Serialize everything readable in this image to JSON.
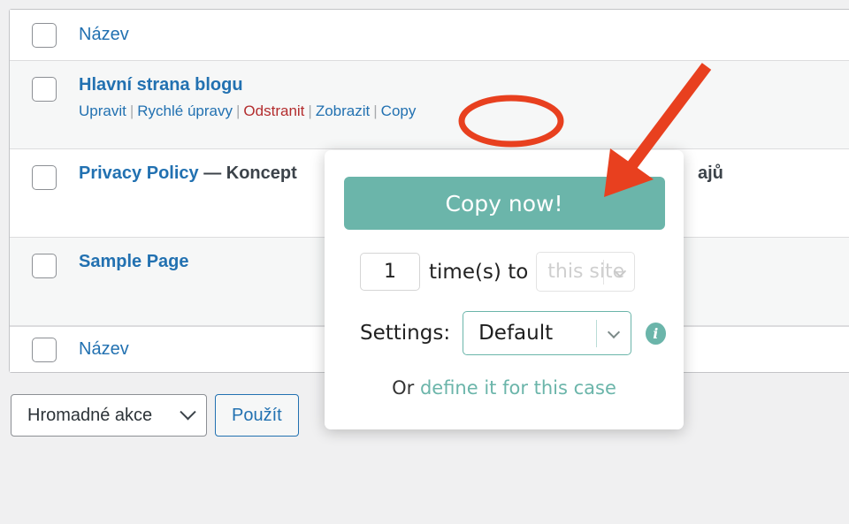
{
  "table": {
    "header": {
      "column_title": "Název"
    },
    "footer": {
      "column_title": "Název"
    },
    "rows": [
      {
        "title": "Hlavní strana blogu",
        "state": "",
        "actions": [
          {
            "label": "Upravit",
            "style": "link"
          },
          {
            "label": "Rychlé úpravy",
            "style": "link"
          },
          {
            "label": "Odstranit",
            "style": "trash"
          },
          {
            "label": "Zobrazit",
            "style": "link"
          },
          {
            "label": "Copy",
            "style": "link"
          }
        ]
      },
      {
        "title": "Privacy Policy",
        "state": "— Koncept",
        "trailing_text": "ajů",
        "actions": []
      },
      {
        "title": "Sample Page",
        "state": "",
        "actions": []
      }
    ]
  },
  "bulk_actions": {
    "select_value": "Hromadné akce",
    "apply_label": "Použít"
  },
  "popup": {
    "copy_now_label": "Copy now!",
    "times_value": "1",
    "times_label": "time(s) to",
    "site_select_value": "this site",
    "settings_label": "Settings:",
    "settings_value": "Default",
    "info_icon_glyph": "i",
    "or_text": "Or",
    "define_link": "define it for this case"
  },
  "annotations": {
    "ellipse_target": "Copy",
    "arrow_target": "Copy now!",
    "accent_red": "#e8401f",
    "accent_teal": "#6bb5aa",
    "link_blue": "#2271b1",
    "trash_red": "#b32d2e"
  }
}
